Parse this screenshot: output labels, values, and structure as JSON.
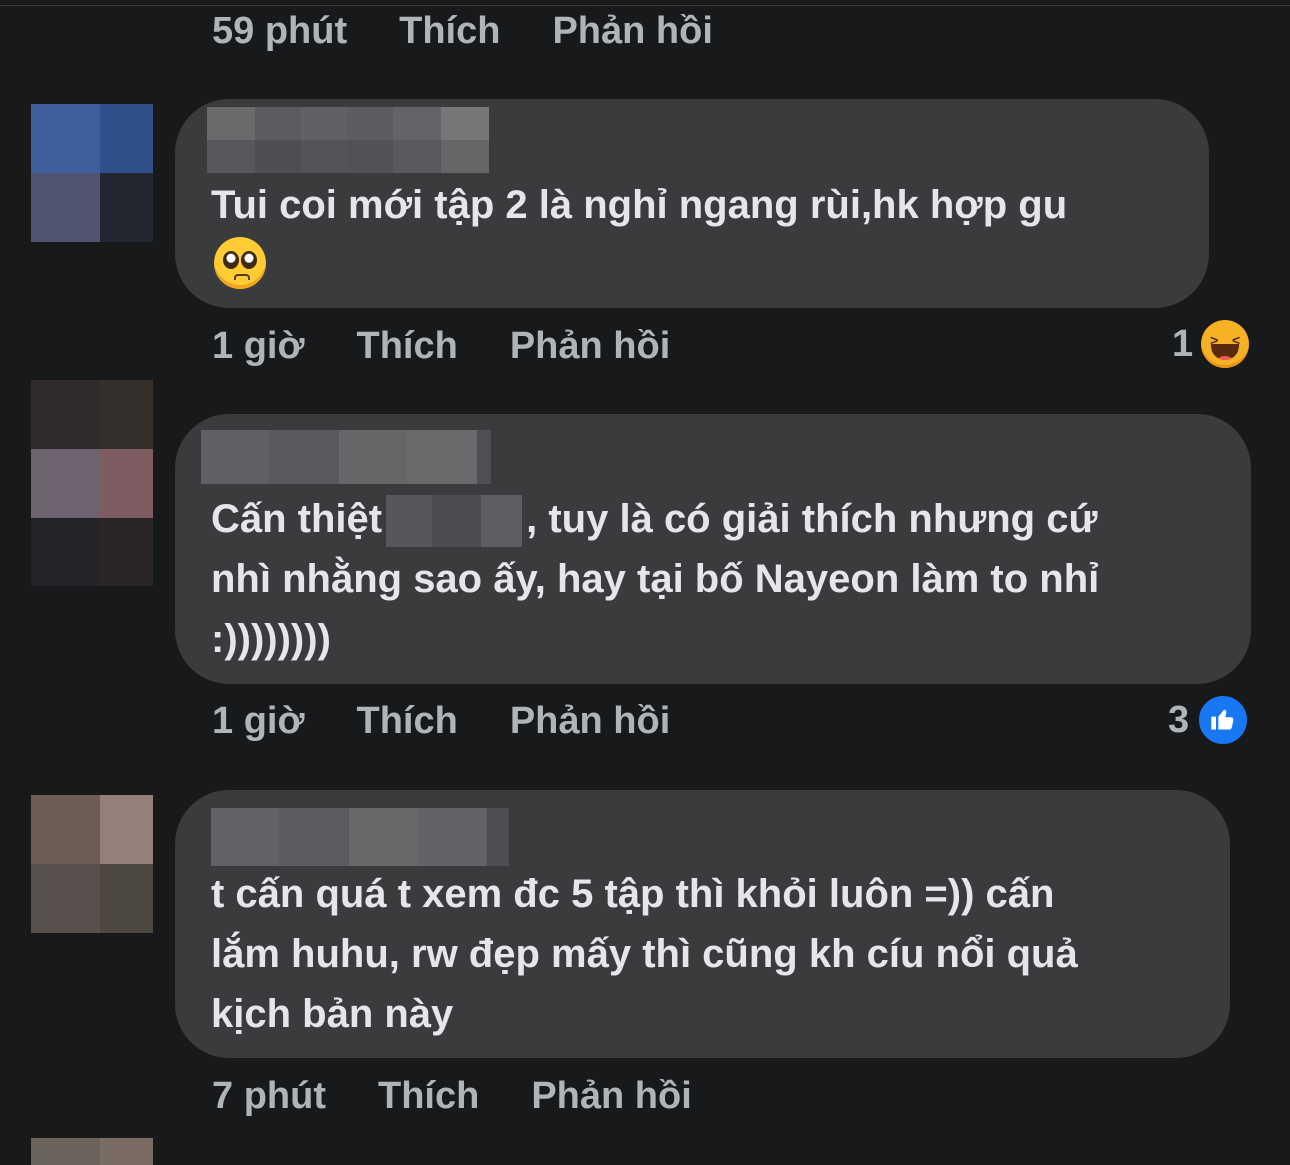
{
  "comments": [
    {
      "time": "59 phút",
      "like_label": "Thích",
      "reply_label": "Phản hồi"
    },
    {
      "text_lines": [
        "Tui coi mới tập 2 là nghỉ ngang rùi,hk hợp gu"
      ],
      "emoji": "pleading-face",
      "time": "1 giờ",
      "like_label": "Thích",
      "reply_label": "Phản hồi",
      "reaction_count": "1",
      "reaction_icon": "haha-icon"
    },
    {
      "text_prefix": "Cấn thiệt",
      "text_suffix": ", tuy là có giải thích nhưng cứ",
      "text_lines": [
        "nhì nhằng sao ấy, hay tại bố Nayeon làm to nhỉ",
        ":))))))))"
      ],
      "time": "1 giờ",
      "like_label": "Thích",
      "reply_label": "Phản hồi",
      "reaction_count": "3",
      "reaction_icon": "like-icon"
    },
    {
      "text_lines": [
        "t cấn quá t xem đc 5 tập thì khỏi luôn =)) cấn",
        "lắm huhu, rw đẹp mấy thì cũng kh cíu nổi quả",
        "kịch bản này"
      ],
      "time": "7 phút",
      "like_label": "Thích",
      "reply_label": "Phản hồi"
    }
  ],
  "colors": {
    "background": "#18191a",
    "bubble": "#3a3b3c",
    "meta_text": "#b0b3b8",
    "comment_text": "#e4e6eb",
    "like_blue": "#1877f2",
    "haha_yellow": "#f7b125"
  }
}
